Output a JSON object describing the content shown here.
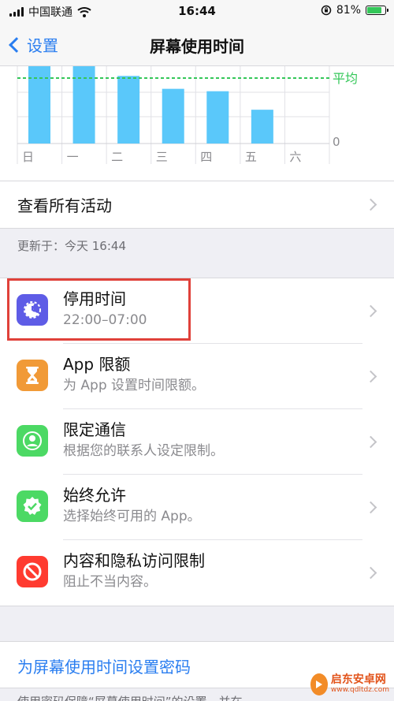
{
  "status_bar": {
    "carrier": "中国联通",
    "time": "16:44",
    "battery_percent": 81,
    "battery_text": "81%"
  },
  "nav": {
    "back_label": "设置",
    "title": "屏幕使用时间"
  },
  "chart_data": {
    "type": "bar",
    "categories": [
      "日",
      "一",
      "二",
      "三",
      "四",
      "五",
      "六"
    ],
    "values": [
      100,
      100,
      84,
      68,
      65,
      42,
      0
    ],
    "average_label": "平均",
    "zero_label": "0",
    "colors": {
      "bar": "#5ac8fa",
      "average": "#34c759",
      "grid": "#e1e1e6"
    }
  },
  "activity": {
    "see_all_label": "查看所有活动",
    "updated_text": "更新于：今天 16:44"
  },
  "settings": [
    {
      "title": "停用时间",
      "subtitle": "22:00–07:00",
      "icon": "downtime-icon",
      "color": "#5e5ce6"
    },
    {
      "title": "App 限额",
      "subtitle": "为 App 设置时间限额。",
      "icon": "hourglass-icon",
      "color": "#f19a37"
    },
    {
      "title": "限定通信",
      "subtitle": "根据您的联系人设定限制。",
      "icon": "contact-icon",
      "color": "#4cd964"
    },
    {
      "title": "始终允许",
      "subtitle": "选择始终可用的 App。",
      "icon": "checkmark-badge-icon",
      "color": "#4cd964"
    },
    {
      "title": "内容和隐私访问限制",
      "subtitle": "阻止不当内容。",
      "icon": "restriction-icon",
      "color": "#ff3b30"
    }
  ],
  "passcode": {
    "link_label": "为屏幕使用时间设置密码",
    "footer_text": "使用密码保障“屏幕使用时间”的设置，并在"
  },
  "watermark": {
    "text": "启东安卓网",
    "url_text": "www.qdltdz.com"
  }
}
